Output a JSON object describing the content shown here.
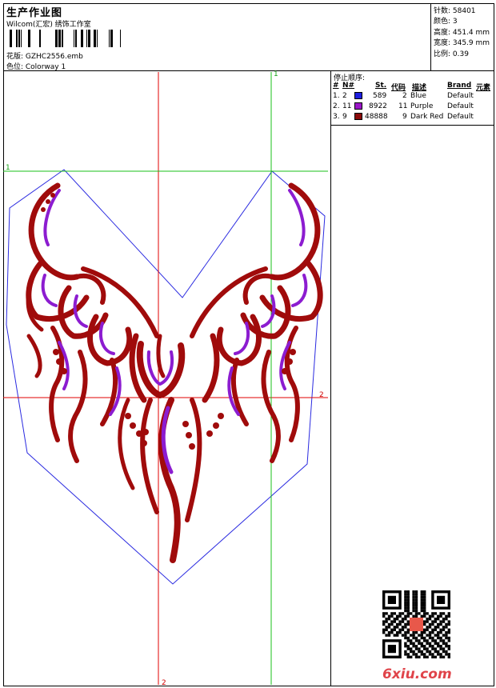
{
  "header": {
    "title": "生产作业图",
    "company": "Wilcom(汇宏) 绣饰工作室",
    "design": "花版:  GZHC2556.emb",
    "colorway": "色位:  Colorway 1"
  },
  "info": {
    "stitches": "针数: 58401",
    "colors": "颜色: 3",
    "height": "高度: 451.4 mm",
    "width": "宽度: 345.9 mm",
    "scale": "比例: 0.39"
  },
  "stop_sequence": {
    "title": "停止顺序:",
    "headers": [
      "#",
      "N#",
      "St.",
      "代码",
      "描述",
      "Brand",
      "元素"
    ],
    "rows": [
      {
        "idx": "1.",
        "n": "2",
        "st": "589",
        "code": "2",
        "desc": "Blue",
        "brand": "Default",
        "color": "#1f1fe0"
      },
      {
        "idx": "2.",
        "n": "11",
        "st": "8922",
        "code": "11",
        "desc": "Purple",
        "brand": "Default",
        "color": "#9b16c8"
      },
      {
        "idx": "3.",
        "n": "9",
        "st": "48888",
        "code": "9",
        "desc": "Dark Red",
        "brand": "Default",
        "color": "#8b0a0a"
      }
    ]
  },
  "guides": {
    "green_v_label": "1",
    "green_h_label": "1",
    "red_h_label": "2",
    "red_v_label": "2"
  },
  "watermark": "6xiu.com",
  "colors": {
    "dark_red": "#a00b0b",
    "purple": "#8c1cd0",
    "blue_outline": "#2a2ae0",
    "guide_red": "#e00000",
    "guide_green": "#18c018"
  }
}
